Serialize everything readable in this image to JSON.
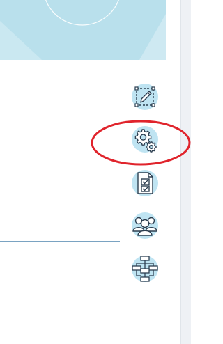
{
  "colors": {
    "banner_bg": "#b9e0ec",
    "icon_bg": "#bfe4f2",
    "icon_stroke": "#2c3e50",
    "annotation": "#e0242c",
    "divider": "#7aa3c2",
    "panel_bg": "#eef1f5"
  },
  "toolbar": {
    "items": [
      {
        "name": "edit",
        "icon": "pencil-edit-icon"
      },
      {
        "name": "settings",
        "icon": "gears-icon",
        "highlighted": true
      },
      {
        "name": "checklist",
        "icon": "checklist-document-icon"
      },
      {
        "name": "users",
        "icon": "users-group-icon"
      },
      {
        "name": "workflow",
        "icon": "flowchart-icon"
      }
    ]
  }
}
